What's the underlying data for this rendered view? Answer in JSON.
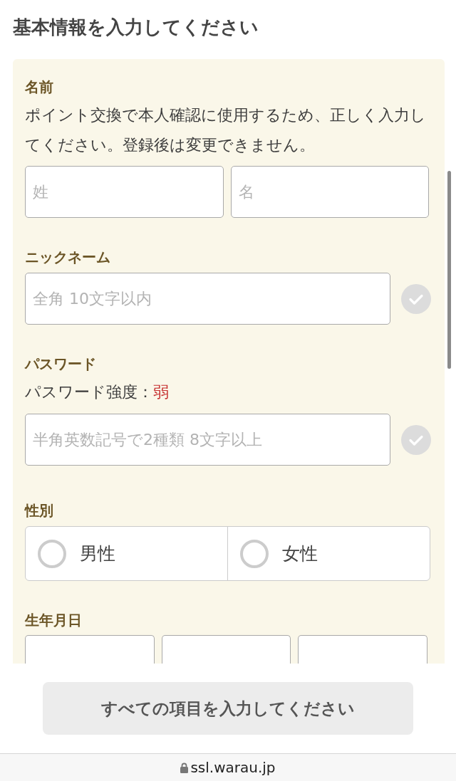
{
  "header": {
    "title": "基本情報を入力してください"
  },
  "form": {
    "sections": [
      {
        "kind": "name",
        "label": "名前",
        "note": "ポイント交換で本人確認に使用するため、正しく入力してください。登録後は変更できません。",
        "fields": [
          {
            "placeholder": "姓"
          },
          {
            "placeholder": "名"
          }
        ]
      },
      {
        "kind": "text",
        "label": "ニックネーム",
        "placeholder": "全角 10文字以内",
        "validated": false
      },
      {
        "kind": "password",
        "label": "パスワード",
        "strength_label": "パスワード強度：",
        "strength": "弱",
        "placeholder": "半角英数記号で2種類 8文字以上",
        "validated": false
      },
      {
        "kind": "radio",
        "label": "性別",
        "options": [
          {
            "label": "男性",
            "selected": false
          },
          {
            "label": "女性",
            "selected": false
          }
        ]
      },
      {
        "kind": "date",
        "label": "生年月日"
      }
    ]
  },
  "submit": {
    "label": "すべての項目を入力してください",
    "disabled": true
  },
  "browser": {
    "url": "ssl.warau.jp",
    "secure": true
  }
}
